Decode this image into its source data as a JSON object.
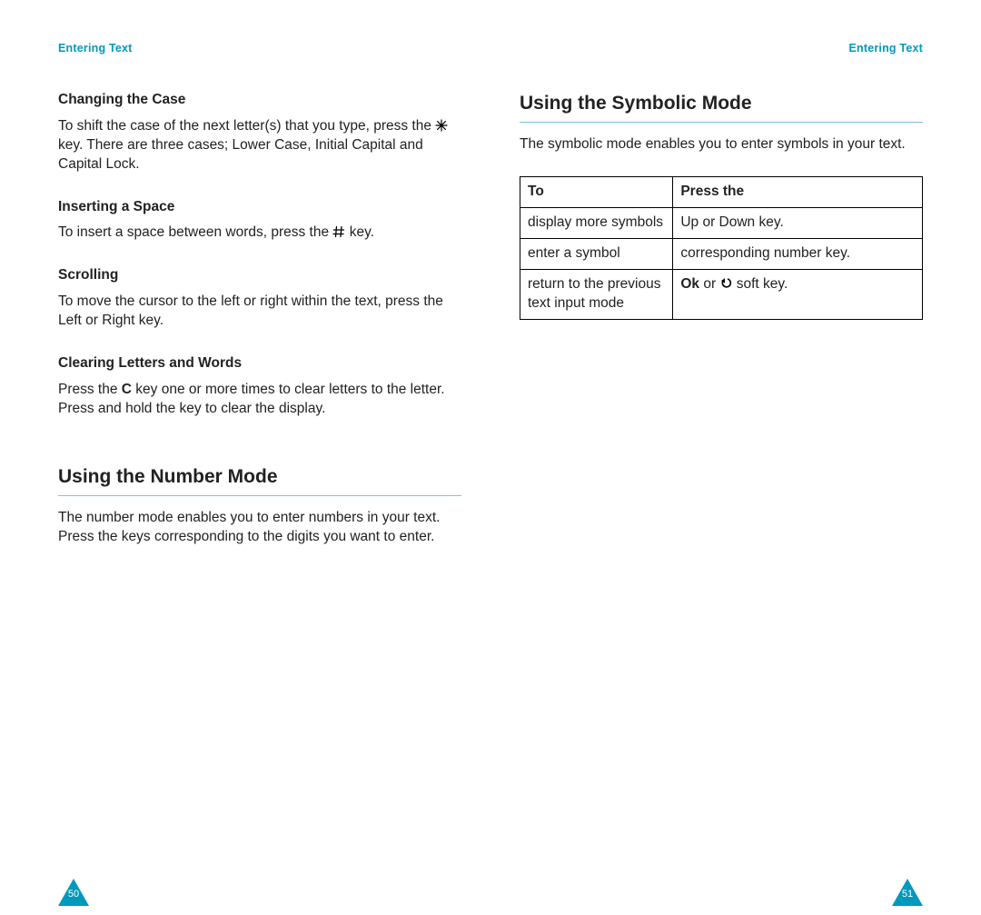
{
  "running_head": {
    "left": "Entering Text",
    "right": "Entering Text"
  },
  "left_page": {
    "sec1": {
      "h": "Changing the Case",
      "p_a": "To shift the case of the next letter(s) that you type, press the ",
      "p_b": " key. There are three cases; Lower Case, Initial Capital and Capital Lock."
    },
    "sec2": {
      "h": "Inserting a Space",
      "p_a": "To insert a space between words, press the ",
      "p_b": " key."
    },
    "sec3": {
      "h": "Scrolling",
      "p": "To move the cursor to the left or right within the text, press the Left or Right key."
    },
    "sec4": {
      "h": "Clearing Letters and Words",
      "p_a": "Press the ",
      "p_bold": "C",
      "p_b": " key one or more times to clear letters to the letter. Press and hold the key to clear the display."
    },
    "section_title": "Using the Number Mode",
    "section_body": "The number mode enables you to enter numbers in your text. Press the keys corresponding to the digits you want to enter."
  },
  "right_page": {
    "section_title": "Using the Symbolic Mode",
    "intro": "The symbolic mode enables you to enter symbols in your text.",
    "table": {
      "head": [
        "To",
        "Press the"
      ],
      "rows": [
        {
          "to": "display more symbols",
          "press": "Up or Down key."
        },
        {
          "to": "enter a symbol",
          "press": "corresponding number key."
        },
        {
          "to": "return to the previous text input mode",
          "press_bold": "Ok",
          "press_a": " or ",
          "press_b": " soft key."
        }
      ]
    }
  },
  "folio": {
    "left": "50",
    "right": "51"
  }
}
